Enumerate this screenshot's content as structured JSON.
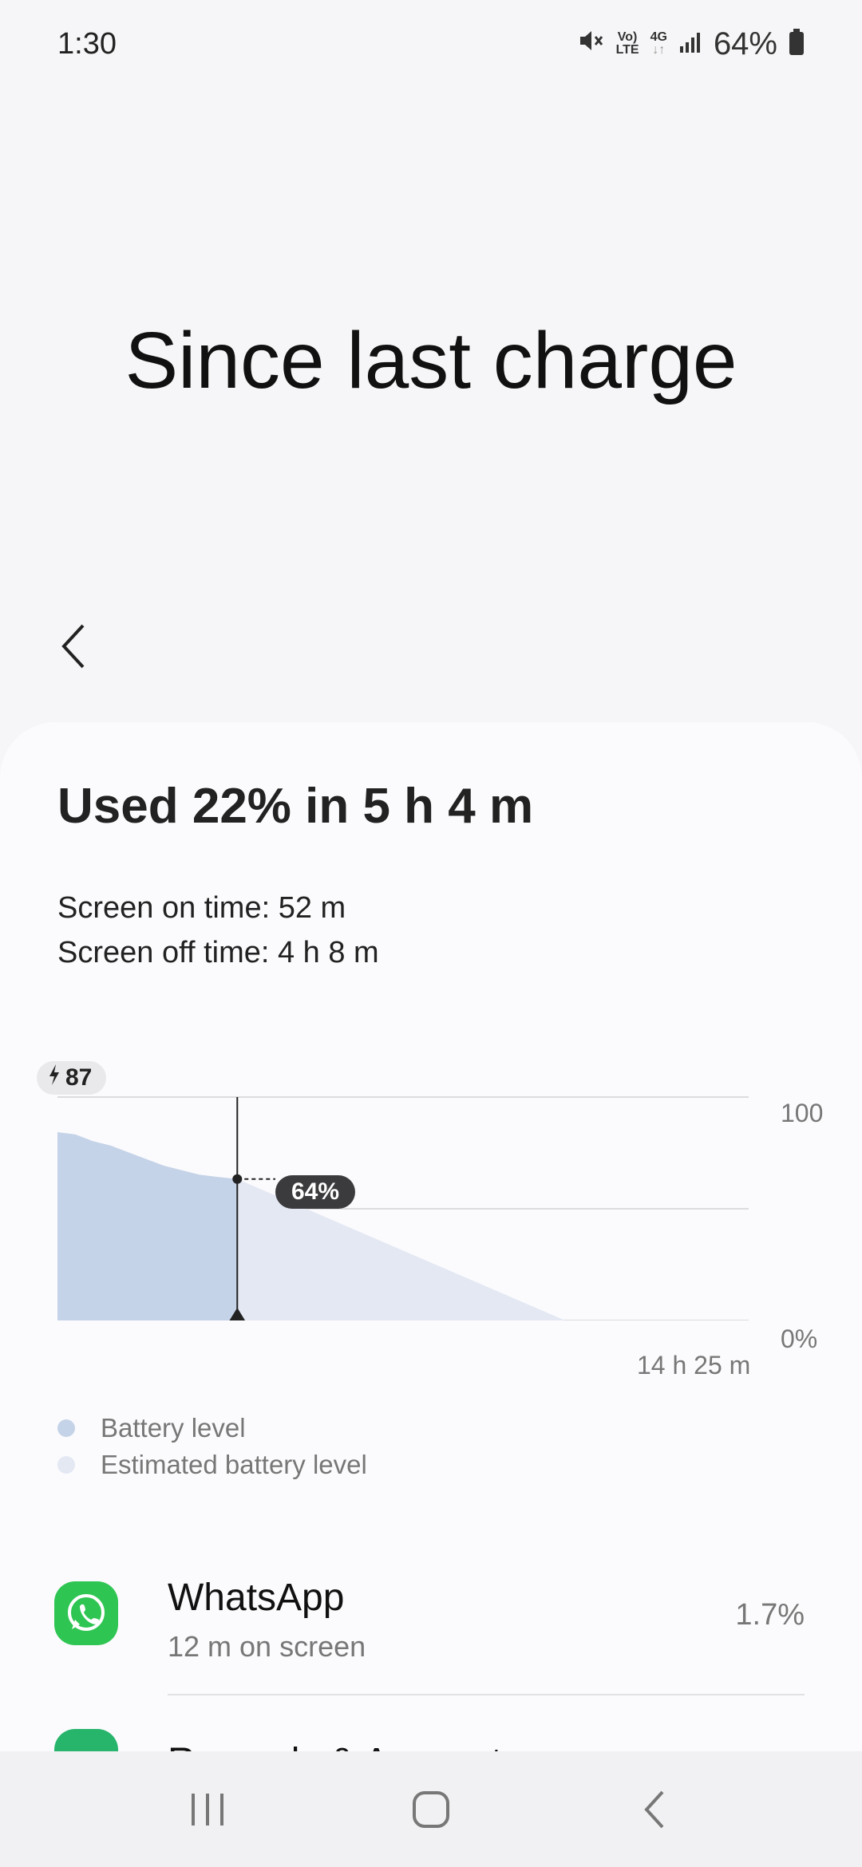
{
  "status": {
    "time": "1:30",
    "volte_top": "Vo)",
    "volte_bottom": "LTE",
    "net_top": "4G",
    "net_bottom": "↓↑",
    "battery": "64%"
  },
  "header": {
    "title": "Since last charge"
  },
  "summary": {
    "used": "Used 22% in 5 h 4 m",
    "screen_on": "Screen on time: 52 m",
    "screen_off": "Screen off time: 4 h 8 m"
  },
  "chart_data": {
    "type": "area",
    "start_level_label": "87",
    "y_tick_top": "100",
    "y_tick_bottom": "0%",
    "x_end_label": "14 h 25 m",
    "current_label": "64%",
    "ylim": [
      0,
      100
    ],
    "series": [
      {
        "name": "Battery level",
        "points": [
          [
            0,
            85
          ],
          [
            0.5,
            84
          ],
          [
            1,
            81
          ],
          [
            1.5,
            79
          ],
          [
            2,
            76
          ],
          [
            2.5,
            73
          ],
          [
            3,
            70
          ],
          [
            3.5,
            68
          ],
          [
            4,
            66
          ],
          [
            4.5,
            65
          ],
          [
            5.07,
            64
          ]
        ]
      },
      {
        "name": "Estimated battery level",
        "points": [
          [
            5.07,
            64
          ],
          [
            14.42,
            0
          ]
        ]
      }
    ],
    "current_time": 5.07,
    "x_range": [
      0,
      19.49
    ],
    "colors": {
      "actual": "#c5d3e8",
      "estimated": "#e3e8f3",
      "line": "#222222",
      "grid": "#dcdcdf"
    }
  },
  "legend": {
    "actual": "Battery level",
    "estimated": "Estimated battery level",
    "actual_color": "#c5d3e8",
    "estimated_color": "#e3e8f3"
  },
  "apps": [
    {
      "name": "WhatsApp",
      "detail": "12 m on screen",
      "percent": "1.7%",
      "icon": "whatsapp-icon"
    }
  ],
  "next_app": {
    "name": "Rewards & Accounts",
    "icon": "app-icon"
  },
  "navbar": {
    "recent": "recent-apps-icon",
    "home": "home-icon",
    "back": "back-icon"
  }
}
